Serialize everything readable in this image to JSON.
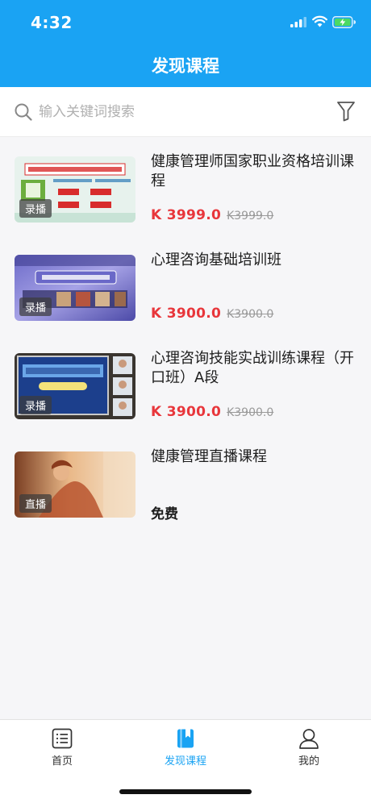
{
  "status_bar": {
    "time": "4:32"
  },
  "header": {
    "title": "发现课程"
  },
  "search": {
    "placeholder": "输入关键词搜索"
  },
  "courses": [
    {
      "name": "健康管理师国家职业资格培训课程",
      "badge": "录播",
      "price": "K 3999.0",
      "original_price": "K3999.0"
    },
    {
      "name": "心理咨询基础培训班",
      "badge": "录播",
      "price": "K 3900.0",
      "original_price": "K3900.0"
    },
    {
      "name": "心理咨询技能实战训练课程（开口班）A段",
      "badge": "录播",
      "price": "K 3900.0",
      "original_price": "K3900.0"
    },
    {
      "name": "健康管理直播课程",
      "badge": "直播",
      "price": "免费"
    }
  ],
  "tabbar": {
    "items": [
      {
        "label": "首页",
        "icon": "home-list-icon"
      },
      {
        "label": "发现课程",
        "icon": "book-icon"
      },
      {
        "label": "我的",
        "icon": "user-icon"
      }
    ],
    "active": 1
  },
  "colors": {
    "brand": "#1aa3f3",
    "price": "#e8363b"
  }
}
